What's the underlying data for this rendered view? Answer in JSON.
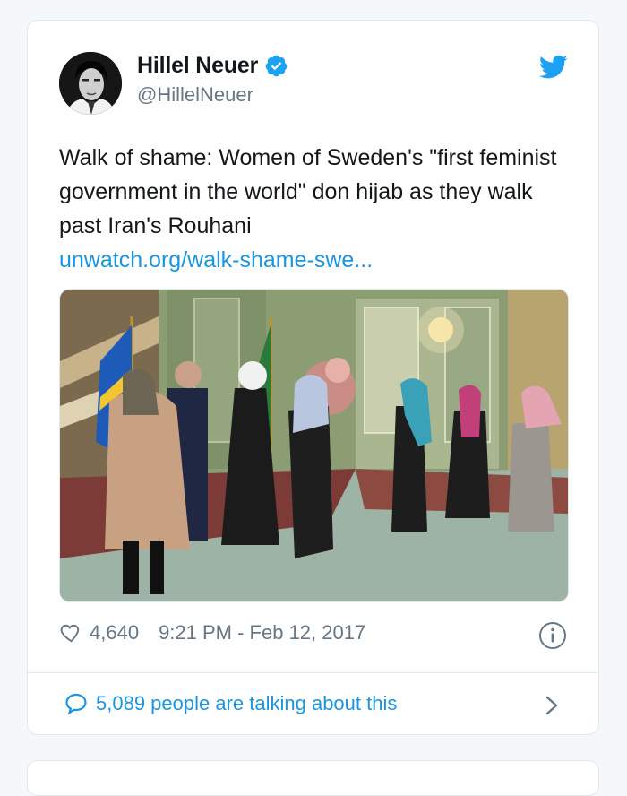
{
  "tweet": {
    "author_name": "Hillel Neuer",
    "author_handle": "@HillelNeuer",
    "text": "Walk of shame: Women of Sweden's \"first feminist government in the world\" don hijab as they walk past Iran's Rouhani",
    "link_text": "unwatch.org/walk-shame-swe...",
    "likes": "4,640",
    "timestamp": "9:21 PM - Feb 12, 2017",
    "talking": "5,089 people are talking about this"
  },
  "icons": {
    "verified": "verified-badge-icon",
    "bird": "twitter-bird-icon",
    "heart": "heart-icon",
    "info": "info-icon",
    "bubble": "speech-bubble-icon",
    "chevron": "chevron-right-icon"
  },
  "colors": {
    "link": "#1b95e0",
    "text": "#14171a",
    "muted": "#657786",
    "border": "#e1e8ed"
  }
}
